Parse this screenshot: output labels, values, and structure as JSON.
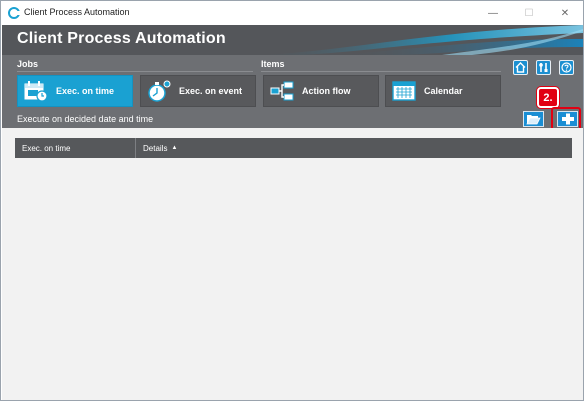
{
  "window": {
    "title": "Client Process Automation",
    "minimize_glyph": "—",
    "maximize_glyph": "☐",
    "close_glyph": "✕"
  },
  "banner": {
    "title": "Client Process Automation"
  },
  "toolbar": {
    "sections": {
      "jobs": "Jobs",
      "items": "Items"
    },
    "buttons": [
      {
        "label": "Exec. on time",
        "icon": "calendar-clock-icon",
        "active": true
      },
      {
        "label": "Exec. on event",
        "icon": "stopwatch-icon",
        "active": false
      },
      {
        "label": "Action flow",
        "icon": "flow-diagram-icon",
        "active": false
      },
      {
        "label": "Calendar",
        "icon": "calendar-grid-icon",
        "active": false
      }
    ],
    "quick_buttons": [
      "home-icon",
      "tools-icon",
      "help-icon"
    ],
    "description": "Execute on decided date and time",
    "actions": [
      "open-folder-icon",
      "add-icon"
    ]
  },
  "annotation": {
    "step": "2."
  },
  "grid": {
    "columns": [
      {
        "label": "Exec. on time"
      },
      {
        "label": "Details",
        "sort": "ascending"
      }
    ],
    "sort_glyph": "▲",
    "rows": []
  },
  "colors": {
    "banner": "#54565a",
    "toolbar": "#6d6f73",
    "active_button": "#1aa1d2",
    "accent_blue": "#1c8fd0",
    "annotation_red": "#e10012"
  }
}
